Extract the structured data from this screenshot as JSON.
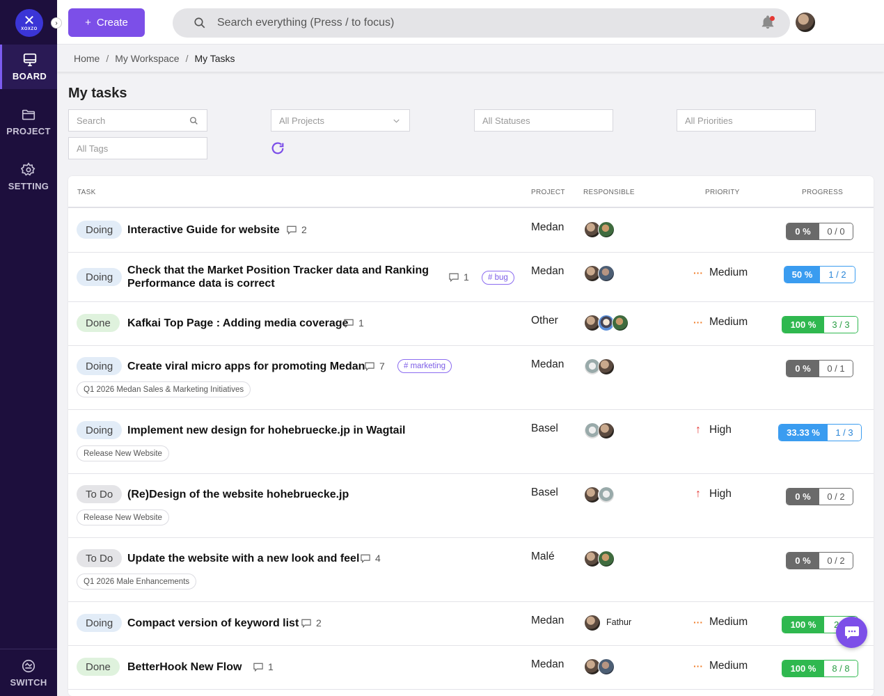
{
  "app": {
    "logo_text": "XOXZO",
    "logo_mark": "✕"
  },
  "sidebar": {
    "items": [
      {
        "label": "BOARD",
        "icon": "monitor-icon",
        "active": true
      },
      {
        "label": "PROJECT",
        "icon": "folder-icon",
        "active": false
      },
      {
        "label": "SETTING",
        "icon": "gear-icon",
        "active": false
      }
    ],
    "switch_label": "SWITCH"
  },
  "topbar": {
    "create_label": "Create",
    "create_icon": "+",
    "search_placeholder": "Search everything (Press / to focus)"
  },
  "breadcrumb": [
    "Home",
    "My Workspace",
    "My Tasks"
  ],
  "page_title": "My tasks",
  "filters": {
    "search_placeholder": "Search",
    "projects": "All Projects",
    "statuses": "All Statuses",
    "priorities": "All Priorities",
    "tags": "All Tags"
  },
  "table": {
    "headers": {
      "task": "TASK",
      "project": "PROJECT",
      "responsible": "RESPONSIBLE",
      "priority": "PRIORITY",
      "progress": "PROGRESS"
    },
    "rows": [
      {
        "status": "Doing",
        "title": "Interactive Guide for website",
        "comments": "2",
        "project": "Medan",
        "priority": "",
        "progress_pct": "0 %",
        "progress_count": "0 / 0"
      },
      {
        "status": "Doing",
        "title": "Check that the Market Position Tracker data and Ranking Performance data is correct",
        "comments": "1",
        "tag": "# bug",
        "project": "Medan",
        "priority": "Medium",
        "progress_pct": "50 %",
        "progress_count": "1 / 2"
      },
      {
        "status": "Done",
        "title": "Kafkai Top Page : Adding media coverage",
        "comments": "1",
        "project": "Other",
        "priority": "Medium",
        "progress_pct": "100 %",
        "progress_count": "3 / 3"
      },
      {
        "status": "Doing",
        "title": "Create viral micro apps for promoting Medan",
        "comments": "7",
        "tag": "# marketing",
        "chip": "Q1 2026 Medan Sales & Marketing Initiatives",
        "project": "Medan",
        "priority": "",
        "progress_pct": "0 %",
        "progress_count": "0 / 1"
      },
      {
        "status": "Doing",
        "title": "Implement new design for hohebruecke.jp in Wagtail",
        "chip": "Release New Website",
        "project": "Basel",
        "priority": "High",
        "progress_pct": "33.33 %",
        "progress_count": "1 / 3"
      },
      {
        "status": "To Do",
        "title": "(Re)Design of the website hohebruecke.jp",
        "chip": "Release New Website",
        "project": "Basel",
        "priority": "High",
        "progress_pct": "0 %",
        "progress_count": "0 / 2"
      },
      {
        "status": "To Do",
        "title": "Update the website with a new look and feel",
        "comments": "4",
        "chip": "Q1 2026 Male Enhancements",
        "project": "Malé",
        "priority": "",
        "progress_pct": "0 %",
        "progress_count": "0 / 2"
      },
      {
        "status": "Doing",
        "title": "Compact version of keyword list",
        "comments": "2",
        "project": "Medan",
        "responsible_name": "Fathur",
        "priority": "Medium",
        "progress_pct": "100 %",
        "progress_count": "2"
      },
      {
        "status": "Done",
        "title": "BetterHook New Flow",
        "comments": "1",
        "project": "Medan",
        "priority": "Medium",
        "progress_pct": "100 %",
        "progress_count": "8 / 8"
      }
    ]
  },
  "colors": {
    "accent": "#7c4fe8",
    "sidebar": "#1d0f3d",
    "progress_gray": "#6a6a6a",
    "progress_blue": "#3a9cf0",
    "progress_green": "#2fb84f",
    "priority_medium": "#f07d2a",
    "priority_high": "#e53935"
  }
}
